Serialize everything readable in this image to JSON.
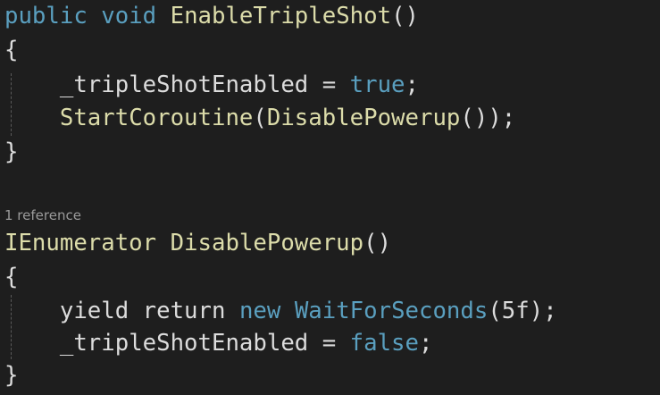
{
  "colors": {
    "background": "#1e1e1e",
    "keyword": "#5a9fbf",
    "identifier": "#dcdcdc",
    "method": "#dcdcaa",
    "codelens": "#9a9a9a"
  },
  "method1": {
    "modifier": "public",
    "return_type": "void",
    "name": "EnableTripleShot",
    "params": "()",
    "open": "{",
    "stmt1": {
      "var": "_tripleShotEnabled",
      "op": " = ",
      "value": "true",
      "end": ";"
    },
    "stmt2": {
      "call": "StartCoroutine",
      "open": "(",
      "inner": "DisablePowerup",
      "inner_params": "()",
      "close": ");"
    },
    "close": "}"
  },
  "codelens": "1 reference",
  "method2": {
    "return_type": "IEnumerator",
    "name": "DisablePowerup",
    "params": "()",
    "open": "{",
    "stmt1": {
      "yield": "yield return ",
      "new": "new ",
      "type": "WaitForSeconds",
      "args": "(5f);"
    },
    "stmt2": {
      "var": "_tripleShotEnabled",
      "op": " = ",
      "value": "false",
      "end": ";"
    },
    "close": "}"
  }
}
